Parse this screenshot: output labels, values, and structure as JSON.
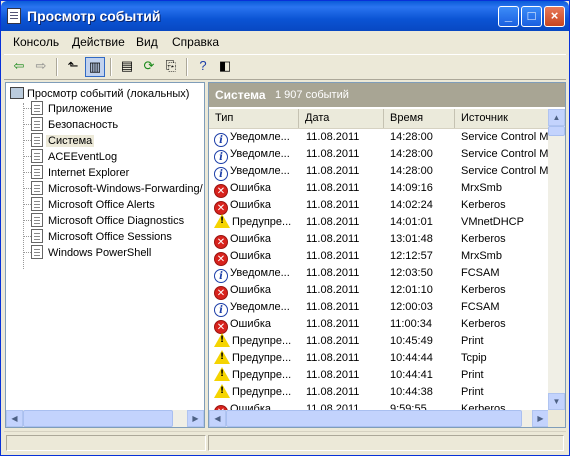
{
  "window": {
    "title": "Просмотр событий"
  },
  "menu": [
    "Консоль",
    "Действие",
    "Вид",
    "Справка"
  ],
  "toolbar": {
    "icons": [
      "back-icon",
      "forward-icon",
      "up-icon",
      "show-hide-tree-icon",
      "properties-icon",
      "refresh-icon",
      "export-icon",
      "help-icon",
      "show-hide-action-pane-icon"
    ]
  },
  "tree": {
    "root": "Просмотр событий (локальных)",
    "items": [
      "Приложение",
      "Безопасность",
      "Система",
      "ACEEventLog",
      "Internet Explorer",
      "Microsoft-Windows-Forwarding/",
      "Microsoft Office Alerts",
      "Microsoft Office Diagnostics",
      "Microsoft Office Sessions",
      "Windows PowerShell"
    ],
    "selected_index": 2
  },
  "list": {
    "title": "Система",
    "count": "1 907 событий",
    "columns": [
      "Тип",
      "Дата",
      "Время",
      "Источник"
    ],
    "rows": [
      {
        "type": "info",
        "type_label": "Уведомле...",
        "date": "11.08.2011",
        "time": "14:28:00",
        "source": "Service Control Ma"
      },
      {
        "type": "info",
        "type_label": "Уведомле...",
        "date": "11.08.2011",
        "time": "14:28:00",
        "source": "Service Control Ma"
      },
      {
        "type": "info",
        "type_label": "Уведомле...",
        "date": "11.08.2011",
        "time": "14:28:00",
        "source": "Service Control Ma"
      },
      {
        "type": "error",
        "type_label": "Ошибка",
        "date": "11.08.2011",
        "time": "14:09:16",
        "source": "MrxSmb"
      },
      {
        "type": "error",
        "type_label": "Ошибка",
        "date": "11.08.2011",
        "time": "14:02:24",
        "source": "Kerberos"
      },
      {
        "type": "warning",
        "type_label": "Предупре...",
        "date": "11.08.2011",
        "time": "14:01:01",
        "source": "VMnetDHCP"
      },
      {
        "type": "error",
        "type_label": "Ошибка",
        "date": "11.08.2011",
        "time": "13:01:48",
        "source": "Kerberos"
      },
      {
        "type": "error",
        "type_label": "Ошибка",
        "date": "11.08.2011",
        "time": "12:12:57",
        "source": "MrxSmb"
      },
      {
        "type": "info",
        "type_label": "Уведомле...",
        "date": "11.08.2011",
        "time": "12:03:50",
        "source": "FCSAM"
      },
      {
        "type": "error",
        "type_label": "Ошибка",
        "date": "11.08.2011",
        "time": "12:01:10",
        "source": "Kerberos"
      },
      {
        "type": "info",
        "type_label": "Уведомле...",
        "date": "11.08.2011",
        "time": "12:00:03",
        "source": "FCSAM"
      },
      {
        "type": "error",
        "type_label": "Ошибка",
        "date": "11.08.2011",
        "time": "11:00:34",
        "source": "Kerberos"
      },
      {
        "type": "warning",
        "type_label": "Предупре...",
        "date": "11.08.2011",
        "time": "10:45:49",
        "source": "Print"
      },
      {
        "type": "warning",
        "type_label": "Предупре...",
        "date": "11.08.2011",
        "time": "10:44:44",
        "source": "Tcpip"
      },
      {
        "type": "warning",
        "type_label": "Предупре...",
        "date": "11.08.2011",
        "time": "10:44:41",
        "source": "Print"
      },
      {
        "type": "warning",
        "type_label": "Предупре...",
        "date": "11.08.2011",
        "time": "10:44:38",
        "source": "Print"
      },
      {
        "type": "error",
        "type_label": "Ошибка",
        "date": "11.08.2011",
        "time": "9:59:55",
        "source": "Kerberos"
      }
    ]
  },
  "colors": {
    "title_bar": "#0a5bd8",
    "list_header": "#a8a594",
    "window_bg": "#ece9d8",
    "error": "#d8221c",
    "warning": "#f5d400",
    "info": "#1c3ea8"
  }
}
